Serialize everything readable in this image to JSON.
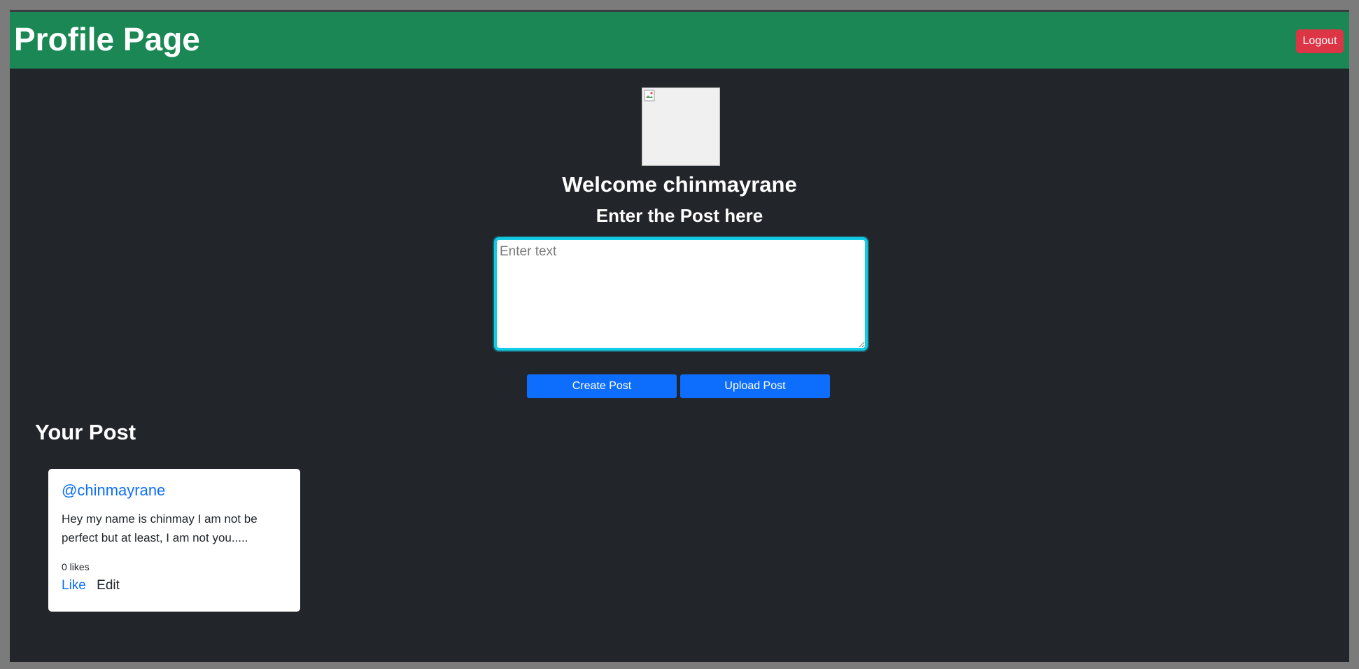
{
  "header": {
    "title": "Profile Page",
    "logout_label": "Logout"
  },
  "profile": {
    "welcome_text": "Welcome chinmayrane",
    "avatar_icon": "broken-image-icon"
  },
  "composer": {
    "heading": "Enter the Post here",
    "placeholder": "Enter text",
    "value": "",
    "create_label": "Create Post",
    "upload_label": "Upload Post"
  },
  "posts_section": {
    "heading": "Your Post",
    "posts": [
      {
        "username": "@chinmayrane",
        "text": "Hey my name is chinmay I am not be perfect but at least, I am not you.....",
        "likes_text": "0 likes",
        "like_label": "Like",
        "edit_label": "Edit"
      }
    ]
  },
  "colors": {
    "header_bg": "#1a8754",
    "page_bg": "#22252a",
    "logout_bg": "#dc3545",
    "primary_button": "#0d6efd",
    "input_focus": "#12cce6"
  }
}
